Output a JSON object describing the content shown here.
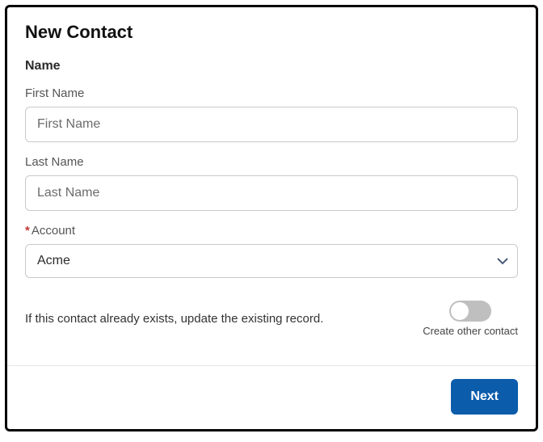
{
  "dialog": {
    "title": "New Contact"
  },
  "section": {
    "name_label": "Name"
  },
  "fields": {
    "first_name": {
      "label": "First Name",
      "placeholder": "First Name",
      "value": ""
    },
    "last_name": {
      "label": "Last Name",
      "placeholder": "Last Name",
      "value": ""
    },
    "account": {
      "label": "Account",
      "required": true,
      "value": "Acme"
    }
  },
  "toggle": {
    "helper": "If this contact already exists, update the existing record.",
    "label": "Create other contact",
    "on": false
  },
  "footer": {
    "next_label": "Next"
  }
}
